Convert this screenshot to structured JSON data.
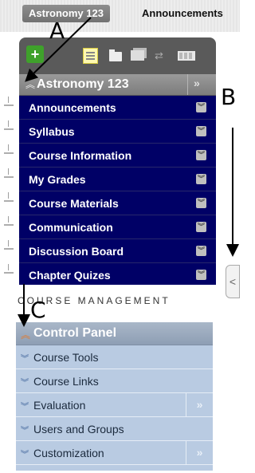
{
  "breadcrumb": {
    "course": "Astronomy 123",
    "page": "Announcements"
  },
  "toolbar": {
    "add_label": "+",
    "icons": [
      "add-icon",
      "list-view-icon",
      "folder-icon",
      "stack-icon",
      "sync-icon",
      "grid-icon"
    ]
  },
  "course_menu": {
    "title": "Astronomy 123",
    "collapse_glyph": "»",
    "items": [
      "Announcements",
      "Syllabus",
      "Course Information",
      "My Grades",
      "Course Materials",
      "Communication",
      "Discussion Board",
      "Chapter Quizes"
    ]
  },
  "side_tab": {
    "glyph": "<"
  },
  "annotations": {
    "a": "A",
    "b": "B",
    "c": "C"
  },
  "course_management": {
    "heading": "COURSE MANAGEMENT",
    "control_panel": "Control Panel",
    "items": [
      {
        "label": "Course Tools",
        "has_more": false
      },
      {
        "label": "Course Links",
        "has_more": false
      },
      {
        "label": "Evaluation",
        "has_more": true
      },
      {
        "label": "Users and Groups",
        "has_more": false
      },
      {
        "label": "Customization",
        "has_more": true
      }
    ]
  },
  "colors": {
    "menu_bg": "#000066",
    "panel_bg": "#5a5a5a",
    "control_panel_bg": "#b9cbe2",
    "accent_orange": "#e47b2c"
  }
}
